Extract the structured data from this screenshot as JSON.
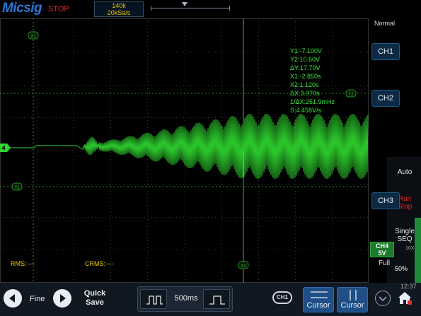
{
  "header": {
    "brand": "Micsig",
    "run_state": "STOP",
    "memory_depth": "140k",
    "sample_rate": "20kSa/s"
  },
  "screen": {
    "channel_marker": "4",
    "cursor_labels": {
      "x1": "X1",
      "x2": "X2",
      "y1": "Y1",
      "y2": "Y2"
    },
    "cursor_readout": [
      "Y1:-7.100V",
      "Y2:10.60V",
      "ΔY:17.70V",
      "X1:-2.850s",
      "X2:1.120s",
      "ΔX:3.970s",
      "1/ΔX:251.9mHz",
      "S:4.458V/s"
    ],
    "rms": "RMS:----",
    "crms": "CRMS:----"
  },
  "right_panel": {
    "mode": "Normal",
    "ch1": "CH1",
    "ch2": "CH2",
    "auto": "Auto",
    "run": "Run",
    "stop": "Stop",
    "ch3": "CH3",
    "single": "Single",
    "seq": "SEQ",
    "ch4_label": "CH4",
    "ch4_scale": "5V",
    "ch4_coupling_probe": "10X",
    "bandwidth": "Full",
    "brightness": "50%"
  },
  "bottom_bar": {
    "fine": "Fine",
    "quick_save_line1": "Quick",
    "quick_save_line2": "Save",
    "timebase": "500ms",
    "cursor_source": "CH1",
    "cursor_h": "Cursor",
    "cursor_v": "Cursor",
    "clock": "12:37"
  },
  "colors": {
    "trace": "#2fd82f",
    "cursor": "#2fbf2f",
    "brand": "#2a78d6",
    "stop": "#e02828",
    "yellow_text": "#e6d100",
    "button_blue": "#1f4f86"
  }
}
